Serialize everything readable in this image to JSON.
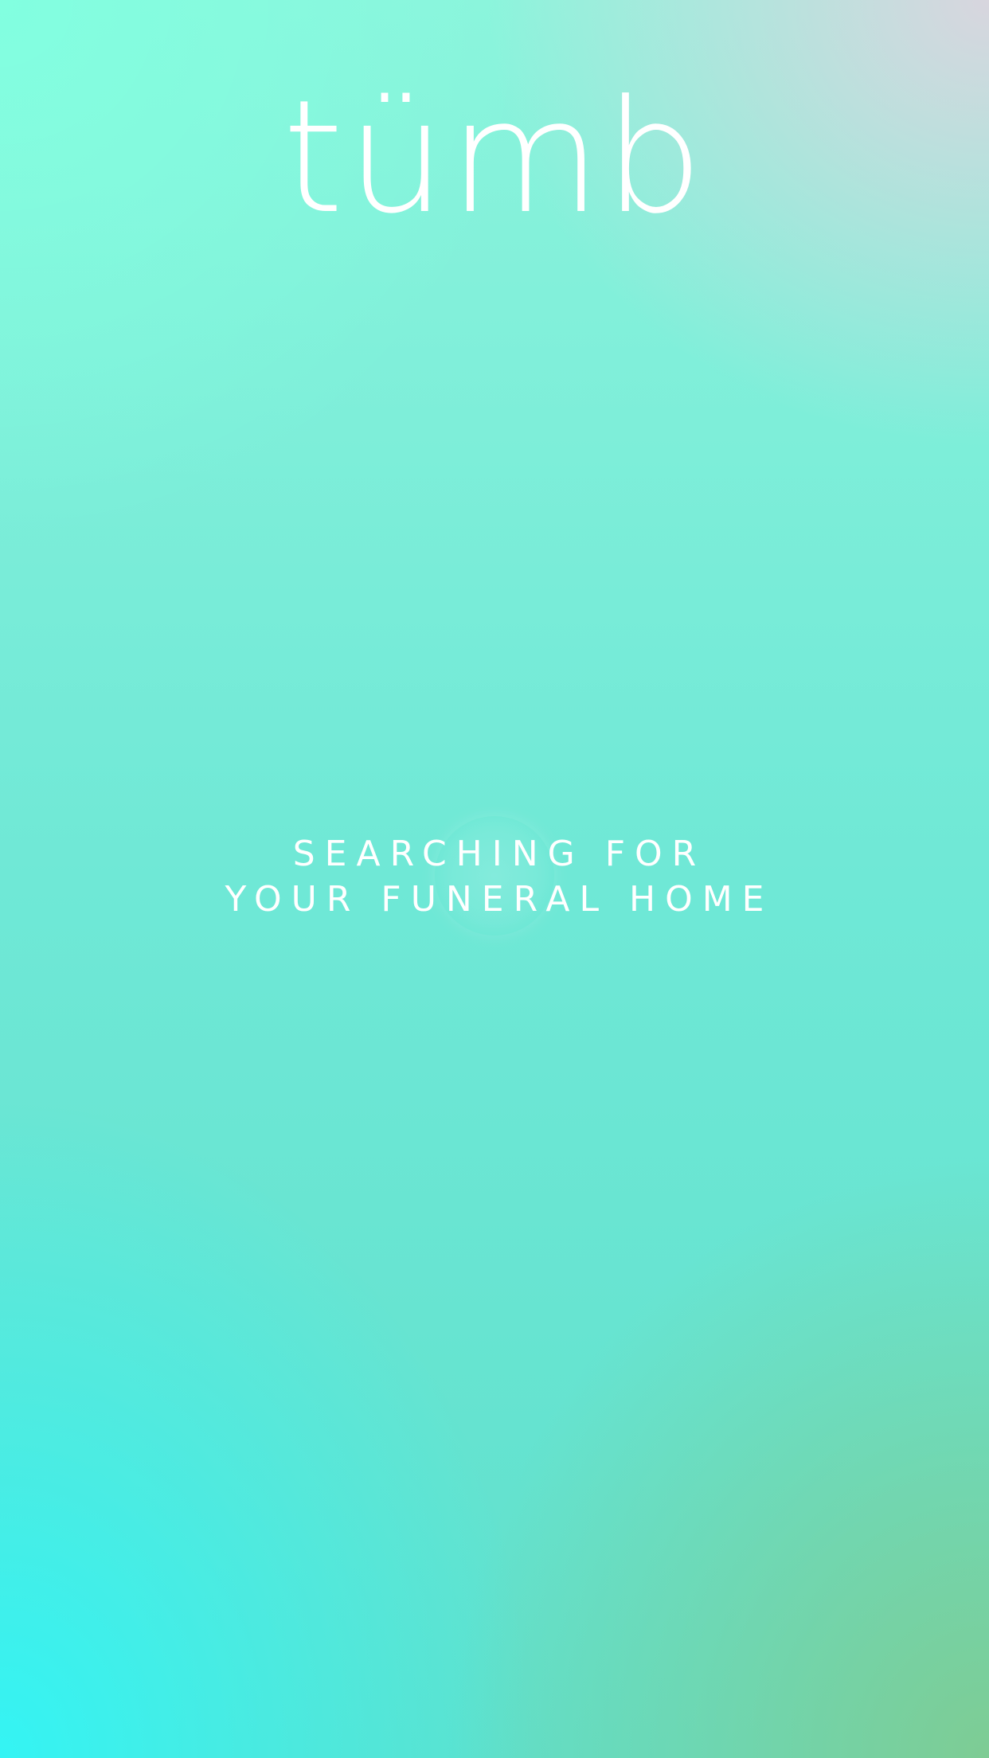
{
  "app": {
    "logo_text": "tümb"
  },
  "loading": {
    "line1": "SEARCHING FOR",
    "line2": "YOUR FUNERAL HOME"
  },
  "colors": {
    "top_left": "#82ffe0",
    "top_right": "#dcd4de",
    "bottom_left": "#34f4f4",
    "bottom_right": "#7ecc94",
    "text": "#ffffff"
  }
}
